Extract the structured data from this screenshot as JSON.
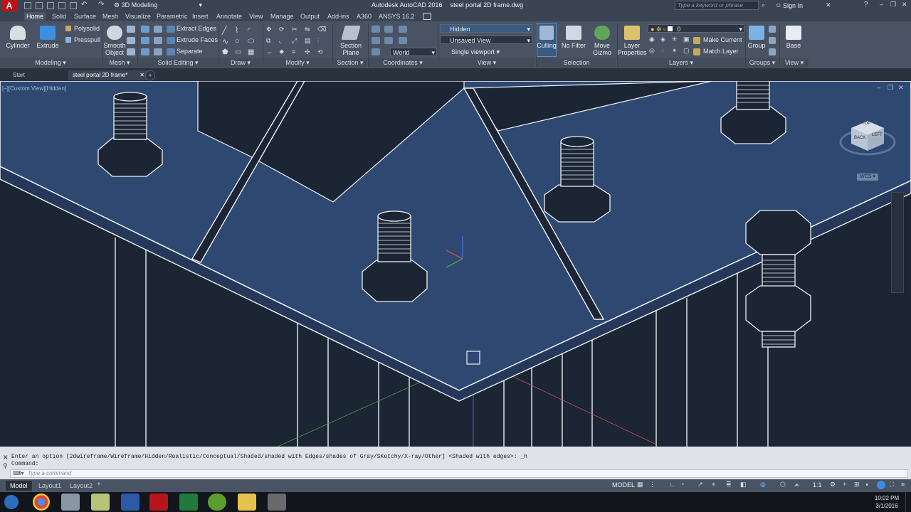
{
  "titlebar": {
    "workspace": "3D Modeling",
    "title_app": "Autodesk AutoCAD 2016",
    "title_file": "steel portal 2D frame.dwg",
    "search_placeholder": "Type a keyword or phrase",
    "sign_in": "Sign In"
  },
  "tabs": [
    "Home",
    "Solid",
    "Surface",
    "Mesh",
    "Visualize",
    "Parametric",
    "Insert",
    "Annotate",
    "View",
    "Manage",
    "Output",
    "Add-ins",
    "A360",
    "ANSYS 16.2"
  ],
  "ribbon": {
    "cylinder": "Cylinder",
    "extrude": "Extrude",
    "polysolid": "Polysolid",
    "presspull": "Presspull",
    "smooth_object_1": "Smooth",
    "smooth_object_2": "Object",
    "extract_edges": "Extract Edges",
    "extrude_faces": "Extrude Faces",
    "separate": "Separate",
    "section_plane_1": "Section",
    "section_plane_2": "Plane",
    "visual_style": "Hidden",
    "saved_view": "Unsaved View",
    "viewport_config": "Single viewport",
    "ucs_world": "World",
    "culling": "Culling",
    "no_filter": "No Filter",
    "move_gizmo_1": "Move",
    "move_gizmo_2": "Gizmo",
    "layer_properties_1": "Layer",
    "layer_properties_2": "Properties",
    "layer_name": "0",
    "make_current": "Make Current",
    "match_layer": "Match Layer",
    "group": "Group",
    "base": "Base",
    "panels": {
      "modeling": "Modeling",
      "mesh": "Mesh",
      "solid_editing": "Solid Editing",
      "draw": "Draw",
      "modify": "Modify",
      "section": "Section",
      "coordinates": "Coordinates",
      "view": "View",
      "selection": "Selection",
      "layers": "Layers",
      "groups": "Groups",
      "view2": "View"
    }
  },
  "filetabs": {
    "start": "Start",
    "active": "steel portal 2D frame*"
  },
  "viewport": {
    "label": "[–][Custom View][Hidden]",
    "wcs": "WCS",
    "cube_labels": [
      "BACK",
      "LEFT",
      "TOP"
    ]
  },
  "command": {
    "history_line1": "Enter an option [2dwireframe/Wireframe/Hidden/Realistic/Conceptual/Shaded/shaded with Edges/shades of Gray/SKetchy/X-ray/Other] <Shaded with edges>: _h",
    "history_line2": "Command:",
    "placeholder": "Type a command"
  },
  "layout_tabs": [
    "Model",
    "Layout1",
    "Layout2"
  ],
  "status": {
    "model": "MODEL",
    "scale": "1:1"
  },
  "taskbar": {
    "time": "10:02 PM",
    "date": "3/1/2016"
  },
  "colors": {
    "plate": "#2f4872",
    "viewport_bg": "#1b2533",
    "ribbon_bg": "#4a5363",
    "accent": "#3d8de0"
  }
}
